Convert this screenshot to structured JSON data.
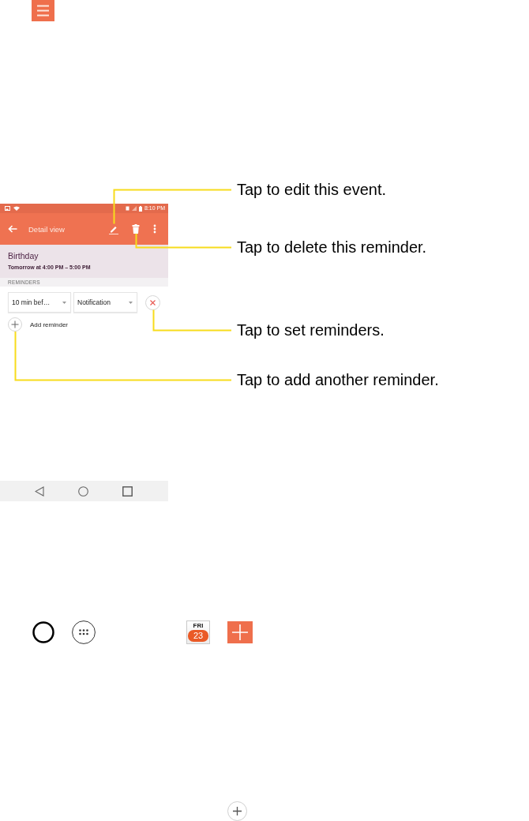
{
  "screenshot": {
    "status_bar": {
      "time": "8:10 PM"
    },
    "app_bar": {
      "title": "Detail view"
    },
    "event": {
      "title": "Birthday",
      "time": "Tomorrow at 4:00 PM – 5:00 PM"
    },
    "reminders": {
      "heading": "REMINDERS",
      "items": [
        {
          "time": "10 min bef…",
          "method": "Notification"
        }
      ],
      "add_label": "Add reminder"
    }
  },
  "callouts": [
    {
      "text": "Tap to edit this event.",
      "kind": "edit"
    },
    {
      "text": "Tap to delete this reminder.",
      "kind": "delete"
    },
    {
      "text": "Tap to set reminders.",
      "kind": "remove"
    },
    {
      "text": "Tap to add another reminder.",
      "kind": "add"
    }
  ],
  "calendar_icon": {
    "weekday": "FRI",
    "date": "23"
  }
}
